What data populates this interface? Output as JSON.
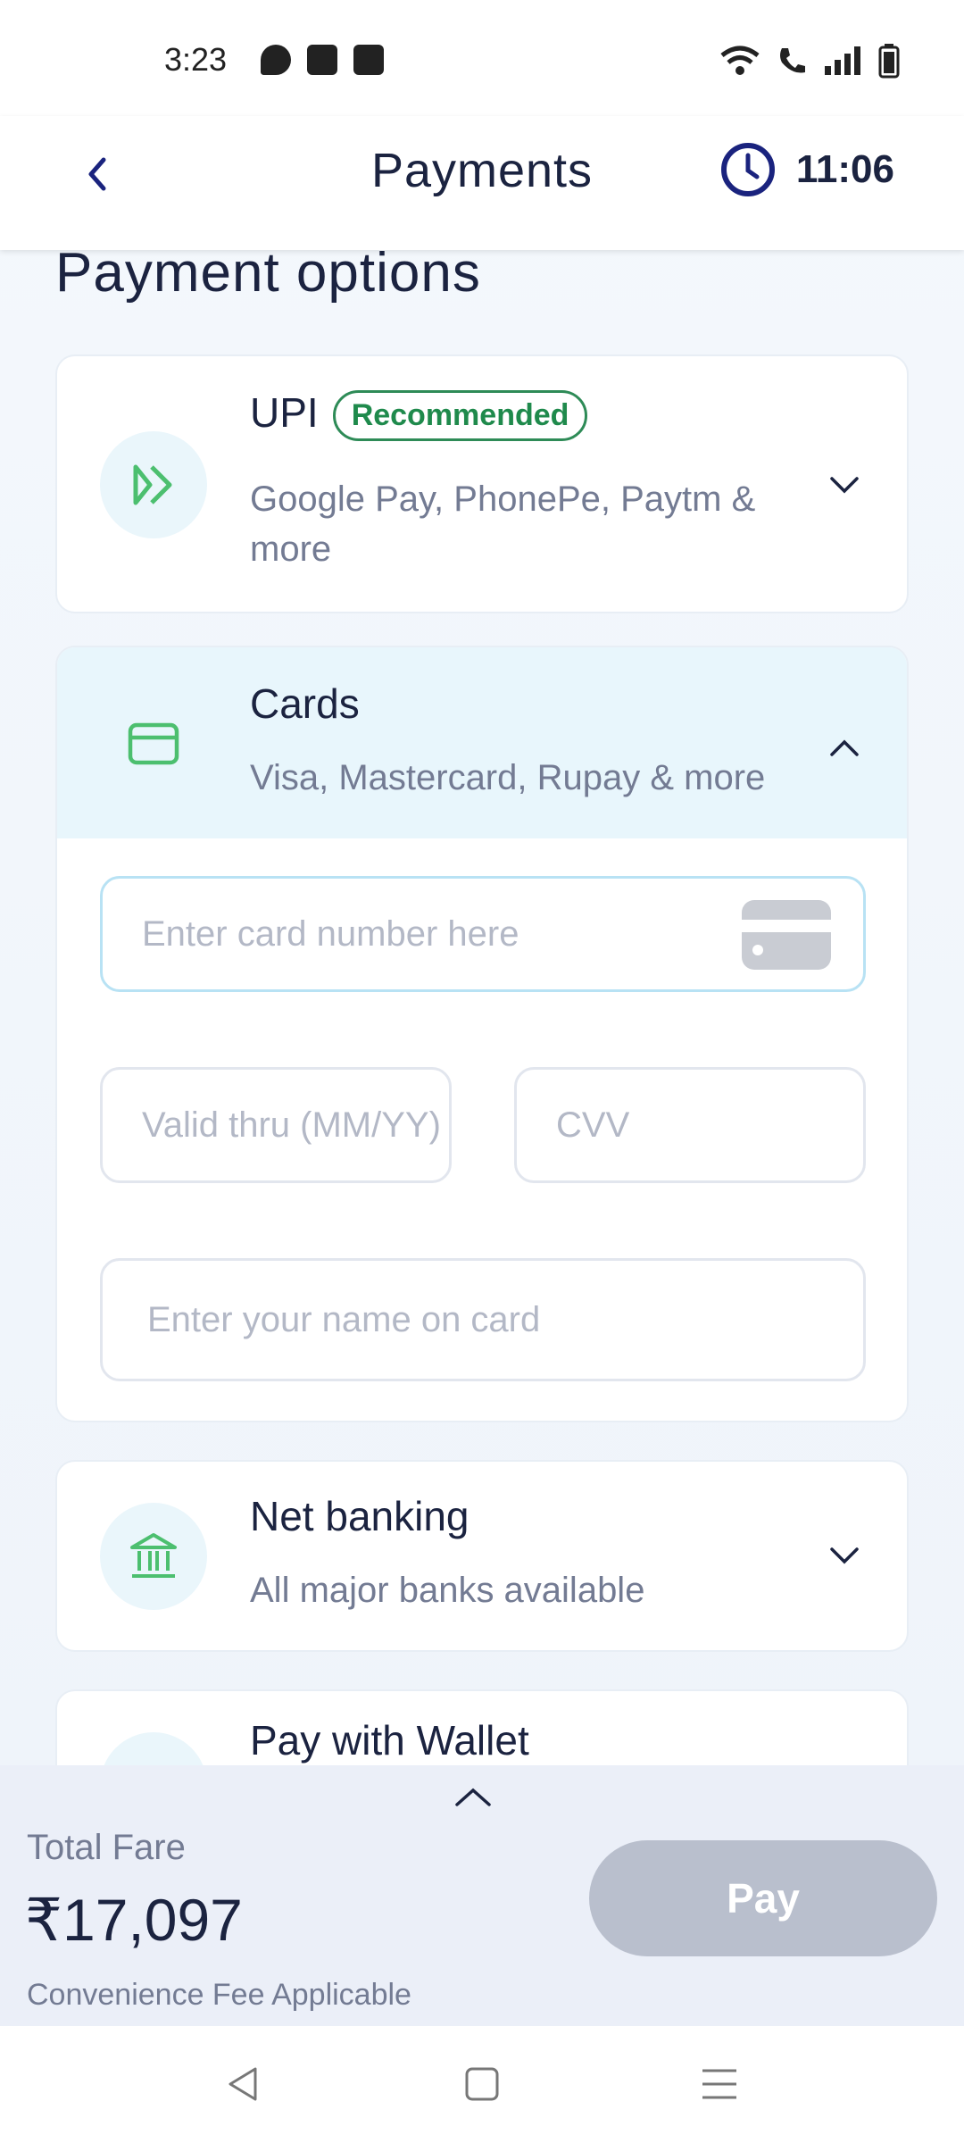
{
  "status_bar": {
    "time": "3:23"
  },
  "header": {
    "title": "Payments",
    "timer": "11:06"
  },
  "section_title": "Payment options",
  "options": {
    "upi": {
      "title": "UPI",
      "badge": "Recommended",
      "subtitle": "Google Pay, PhonePe, Paytm & more"
    },
    "cards": {
      "title": "Cards",
      "subtitle": "Visa, Mastercard, Rupay & more"
    },
    "net_banking": {
      "title": "Net banking",
      "subtitle": "All major banks available"
    },
    "wallet": {
      "title": "Pay with Wallet"
    }
  },
  "card_form": {
    "card_number_placeholder": "Enter card number here",
    "valid_thru_placeholder": "Valid thru (MM/YY)",
    "cvv_placeholder": "CVV",
    "name_placeholder": "Enter your name on card"
  },
  "footer": {
    "total_label": "Total Fare",
    "total_amount": "₹17,097",
    "fee_note": "Convenience Fee Applicable",
    "pay_label": "Pay"
  },
  "colors": {
    "accent_navy": "#1b2340",
    "icon_green": "#4cbf6f",
    "badge_green": "#1f8a4c",
    "selected_bg": "#e8f6fc",
    "pay_disabled": "#b9bfcd"
  }
}
